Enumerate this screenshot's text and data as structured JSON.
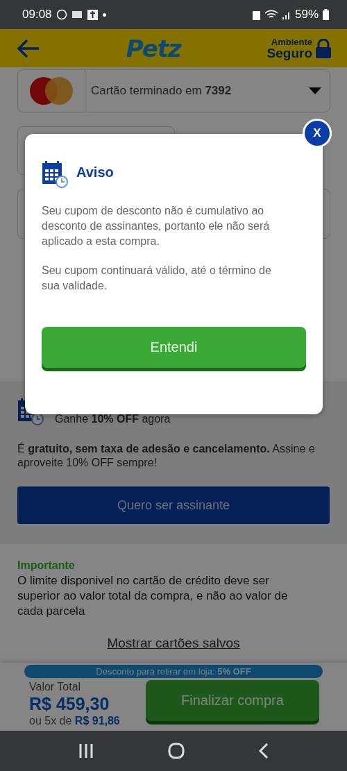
{
  "status_bar": {
    "time": "09:08",
    "battery": "59%"
  },
  "header": {
    "logo": "Petz",
    "secure_top": "Ambiente",
    "secure_bottom": "Seguro"
  },
  "payment": {
    "card_label": "Cartão terminado em **7392**"
  },
  "subscription": {
    "headline": "Ganhe **10% OFF** agora",
    "text": "É **gratuito, sem taxa de adesão e cancelamento.** Assine e aproveite 10% OFF sempre!",
    "button": "Quero ser assinante"
  },
  "notice": {
    "title": "Importante",
    "text": "O limite disponivel no cartão de crédito deve ser superior ao valor total da compra, e não ao valor de cada parcela"
  },
  "saved_cards_link": "Mostrar cartões salvos",
  "footer": {
    "discount_badge": "Desconto para retirar em loja: **5% OFF**",
    "total_label": "Valor Total",
    "total": "R$ 459,30",
    "installments": "ou 5x de **R$ 91,86**",
    "checkout_button": "Finalizar compra"
  },
  "dialog": {
    "close": "X",
    "title": "Aviso",
    "paragraphs": [
      "Seu cupom de desconto não é cumulativo ao desconto de assinantes, portanto ele não será aplicado a esta compra.",
      "Seu cupom continuará válido, até o término de sua validade."
    ],
    "button": "Entendi"
  }
}
